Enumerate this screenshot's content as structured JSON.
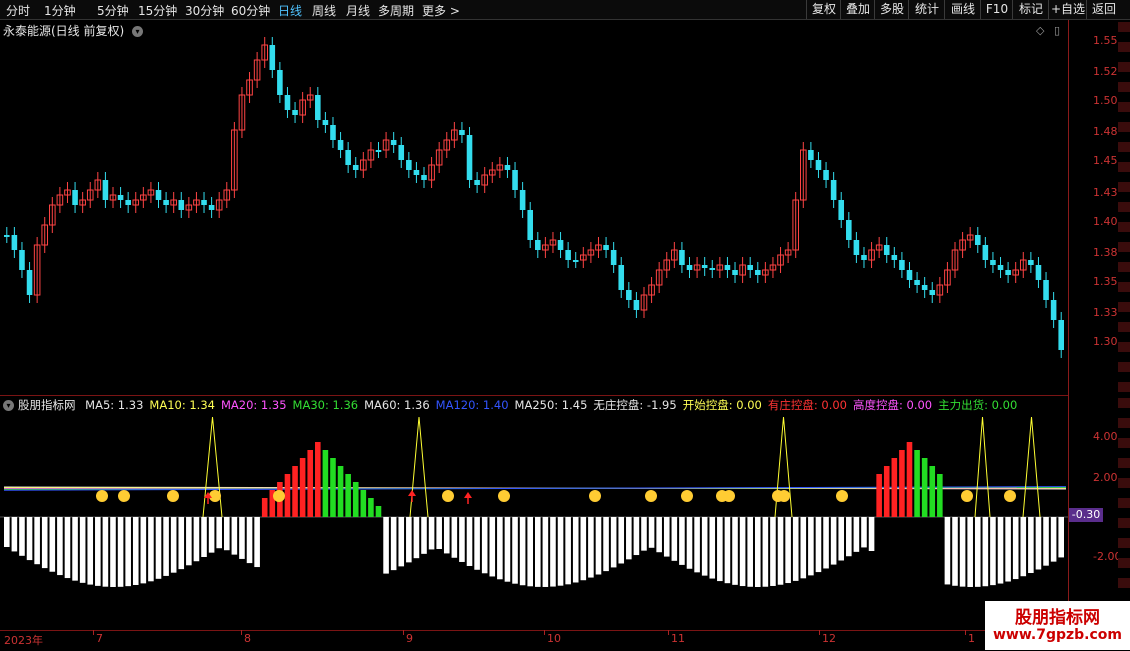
{
  "toolbar": {
    "tabs": [
      "分时",
      "1分钟",
      "5分钟",
      "15分钟",
      "30分钟",
      "60分钟",
      "日线",
      "周线",
      "月线",
      "多周期",
      "更多 >"
    ],
    "active_tab": "日线",
    "right_buttons": [
      "复权",
      "叠加",
      "多股",
      "统计",
      "画线",
      "F10",
      "标记",
      "+自选",
      "返回"
    ]
  },
  "chart_title": "永泰能源(日线 前复权)",
  "price_axis": [
    "1.55",
    "1.52",
    "1.50",
    "1.48",
    "1.45",
    "1.43",
    "1.40",
    "1.38",
    "1.35",
    "1.33",
    "1.30"
  ],
  "indicator": {
    "name": "股朋指标网",
    "values": [
      {
        "label": "MA5:",
        "value": "1.33",
        "color": "#e6e6e6"
      },
      {
        "label": "MA10:",
        "value": "1.34",
        "color": "#ffff55"
      },
      {
        "label": "MA20:",
        "value": "1.35",
        "color": "#ff55ff"
      },
      {
        "label": "MA30:",
        "value": "1.36",
        "color": "#33dd33"
      },
      {
        "label": "MA60:",
        "value": "1.36",
        "color": "#e6e6e6"
      },
      {
        "label": "MA120:",
        "value": "1.40",
        "color": "#3355ff"
      },
      {
        "label": "MA250:",
        "value": "1.45",
        "color": "#e6e6e6"
      },
      {
        "label": "无庄控盘:",
        "value": "-1.95",
        "color": "#e6e6e6"
      },
      {
        "label": "开始控盘:",
        "value": "0.00",
        "color": "#ffff55"
      },
      {
        "label": "有庄控盘:",
        "value": "0.00",
        "color": "#ff3333"
      },
      {
        "label": "高度控盘:",
        "value": "0.00",
        "color": "#ff55ff"
      },
      {
        "label": "主力出货:",
        "value": "0.00",
        "color": "#33dd33"
      }
    ],
    "axis": [
      "4.00",
      "2.00",
      "-2.00"
    ],
    "current": "-0.30"
  },
  "dates": {
    "year_label": "2023年",
    "months": [
      "7",
      "8",
      "9",
      "10",
      "11",
      "12",
      "1"
    ]
  },
  "watermark": {
    "line1": "股朋指标网",
    "line2": "www.7gpzb.com"
  },
  "colors": {
    "up": "#ff4444",
    "down": "#33ddee",
    "accent": "#4fc3ff"
  }
}
